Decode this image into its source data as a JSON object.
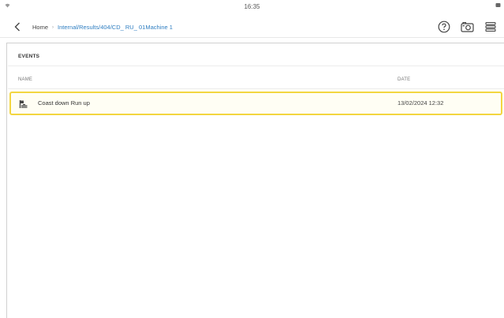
{
  "status_bar": {
    "time": "16:35",
    "wifi_icon": "wifi-icon",
    "battery_icon": "battery-icon"
  },
  "header": {
    "back_icon": "chevron-left-icon",
    "breadcrumb": {
      "home": "Home",
      "separator": "›",
      "path": "Internal/Results/404/CD_ RU_ 01Machine 1"
    },
    "actions": [
      {
        "name": "help",
        "icon": "help-icon"
      },
      {
        "name": "camera",
        "icon": "camera-icon"
      },
      {
        "name": "menu",
        "icon": "menu-icon"
      }
    ]
  },
  "events_panel": {
    "title": "EVENTS",
    "columns": {
      "name": "NAME",
      "date": "DATE"
    },
    "rows": [
      {
        "icon": "event-icon",
        "name": "Coast down Run up",
        "date": "13/02/2024 12:32",
        "selected": true
      }
    ]
  },
  "colors": {
    "accent_link": "#2f7ec1",
    "selection_border": "#f3d640",
    "text": "#333333"
  }
}
